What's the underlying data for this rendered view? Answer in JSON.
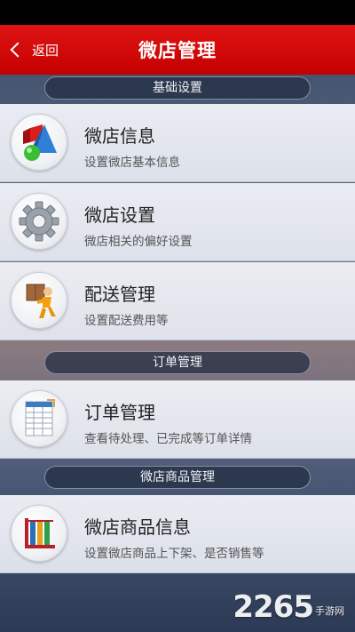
{
  "header": {
    "back_label": "返回",
    "title": "微店管理"
  },
  "sections": [
    {
      "label": "基础设置"
    },
    {
      "label": "订单管理"
    },
    {
      "label": "微店商品管理"
    }
  ],
  "items": [
    {
      "title": "微店信息",
      "subtitle": "设置微店基本信息",
      "icon": "shapes-icon"
    },
    {
      "title": "微店设置",
      "subtitle": "微店相关的偏好设置",
      "icon": "gear-icon"
    },
    {
      "title": "配送管理",
      "subtitle": "设置配送费用等",
      "icon": "delivery-icon"
    },
    {
      "title": "订单管理",
      "subtitle": "查看待处理、已完成等订单详情",
      "icon": "document-icon"
    },
    {
      "title": "微店商品信息",
      "subtitle": "设置微店商品上下架、是否销售等",
      "icon": "books-icon"
    }
  ],
  "watermark": {
    "number": "2265",
    "text": "手游网"
  }
}
